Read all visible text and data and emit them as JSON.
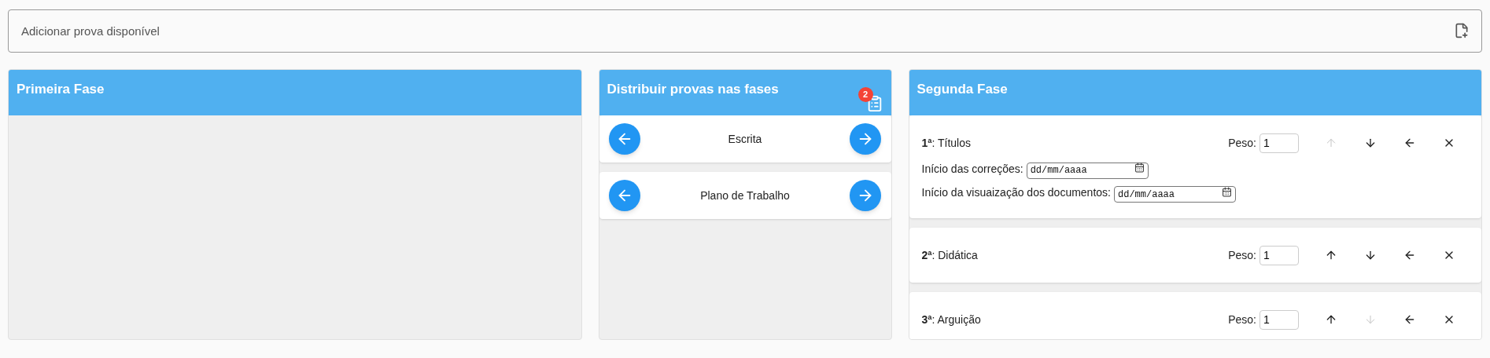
{
  "add_field": {
    "placeholder": "Adicionar prova disponível"
  },
  "panels": [
    {
      "kind": "phase",
      "title": "Primeira Fase"
    },
    {
      "kind": "distribute",
      "title": "Distribuir provas nas fases",
      "badge": "2",
      "items": [
        {
          "label": "Escrita"
        },
        {
          "label": "Plano de Trabalho"
        }
      ]
    },
    {
      "kind": "phase",
      "title": "Segunda Fase",
      "items": [
        {
          "label": "**1ª**: Títulos",
          "weight_label": "Peso:",
          "weight": "1",
          "actions": [
            {
              "kind": "up",
              "disabled": true
            },
            {
              "kind": "down",
              "disabled": false
            },
            {
              "kind": "left",
              "disabled": false
            },
            {
              "kind": "remove",
              "disabled": false
            }
          ],
          "dates": [
            {
              "label": "Início das correções:",
              "placeholder": "dd/mm/aaaa"
            },
            {
              "label": "Início da visuaização dos documentos:",
              "placeholder": "dd/mm/aaaa"
            }
          ]
        },
        {
          "label": "**2ª**: Didática",
          "weight_label": "Peso:",
          "weight": "1",
          "actions": [
            {
              "kind": "up",
              "disabled": false
            },
            {
              "kind": "down",
              "disabled": false
            },
            {
              "kind": "left",
              "disabled": false
            },
            {
              "kind": "remove",
              "disabled": false
            }
          ]
        },
        {
          "label": "**3ª**: Arguição",
          "weight_label": "Peso:",
          "weight": "1",
          "actions": [
            {
              "kind": "up",
              "disabled": false
            },
            {
              "kind": "down",
              "disabled": true
            },
            {
              "kind": "left",
              "disabled": false
            },
            {
              "kind": "remove",
              "disabled": false
            }
          ]
        }
      ]
    }
  ]
}
